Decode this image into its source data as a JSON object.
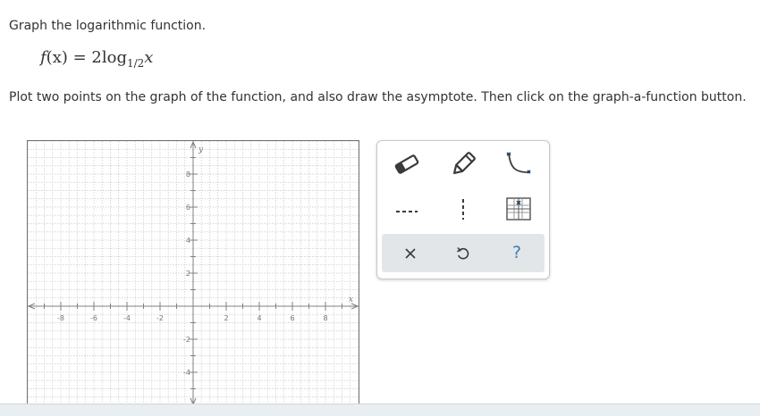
{
  "question": {
    "prompt": "Graph the logarithmic function.",
    "formula": {
      "lhs": "f",
      "arg": "(x)",
      "eq": " = 2log",
      "base": "1/2",
      "var": "x"
    },
    "instruction": "Plot two points on the graph of the function, and also draw the asymptote. Then click on the graph-a-function button."
  },
  "graph": {
    "x_axis_label": "x",
    "y_axis_label": "y",
    "x_tick_labels": [
      "-8",
      "-6",
      "-4",
      "-2",
      "2",
      "4",
      "6",
      "8"
    ],
    "y_tick_labels": [
      "8",
      "6",
      "4",
      "2",
      "-2",
      "-4"
    ],
    "x_range": [
      -10,
      10
    ],
    "y_range": [
      -6,
      10
    ],
    "grid": true
  },
  "toolbox": {
    "tools": [
      "segment-tool-icon",
      "pencil-icon",
      "curve-tool-icon",
      "horizontal-dashed-line-icon",
      "vertical-dashed-line-icon",
      "graph-function-icon"
    ],
    "actions": {
      "clear": "×",
      "undo": "undo-icon",
      "help": "?"
    }
  },
  "colors": {
    "tool_icon": "#3b3b3b",
    "action_bar": "#e2e6e8",
    "help": "#3a7fb4",
    "grid_line": "#c9c9c9",
    "axis": "#808080"
  }
}
